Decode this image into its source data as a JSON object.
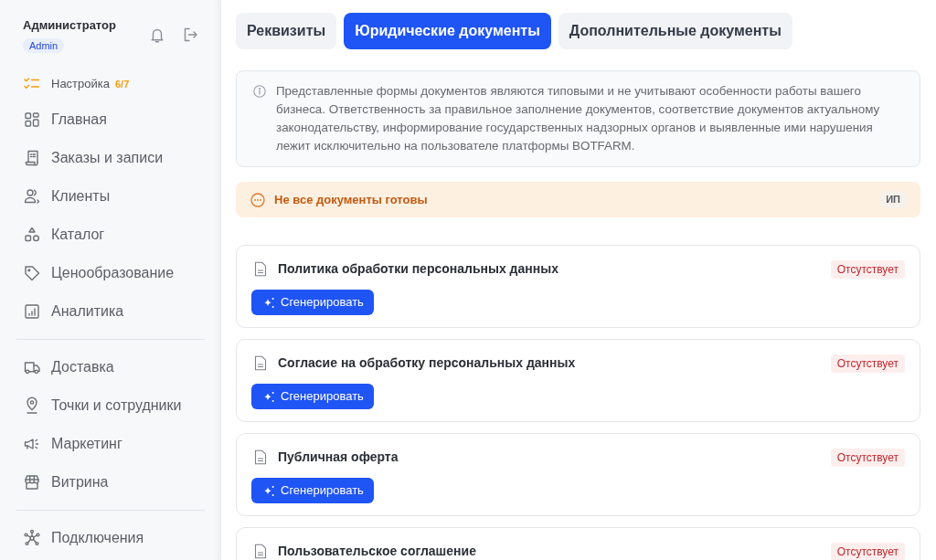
{
  "sidebar": {
    "user": {
      "name": "Администратор",
      "role": "Admin"
    },
    "setup": {
      "label": "Настройка",
      "progress": "6/7"
    },
    "sections": [
      {
        "items": [
          {
            "label": "Главная",
            "selected": false
          },
          {
            "label": "Заказы и записи",
            "selected": false
          },
          {
            "label": "Клиенты",
            "selected": false
          },
          {
            "label": "Каталог",
            "selected": false
          },
          {
            "label": "Ценообразование",
            "selected": false
          },
          {
            "label": "Аналитика",
            "selected": false
          }
        ]
      },
      {
        "items": [
          {
            "label": "Доставка",
            "selected": false
          },
          {
            "label": "Точки и сотрудники",
            "selected": false
          },
          {
            "label": "Маркетинг",
            "selected": false
          },
          {
            "label": "Витрина",
            "selected": false
          }
        ]
      },
      {
        "items": [
          {
            "label": "Подключения",
            "selected": false
          }
        ]
      }
    ]
  },
  "tabs": [
    {
      "label": "Реквизиты",
      "selected": false
    },
    {
      "label": "Юридические документы",
      "selected": true
    },
    {
      "label": "Дополнительные документы",
      "selected": false
    }
  ],
  "notice": {
    "text": "Представленные формы документов являются типовыми и не учитывают особенности работы вашего бизнеса. Ответственность за правильное заполнение документов, соответствие документов актуальному законодательству, информирование государственных надзорных органов и выявленные ими нарушения лежит исключительно на пользователе платформы BOTFARM."
  },
  "warning": {
    "text": "Не все документы готовы",
    "badge": "ИП"
  },
  "documents": [
    {
      "title": "Политика обработки персональных данных",
      "status": "Отсутствует",
      "action": "Сгенерировать"
    },
    {
      "title": "Согласие на обработку персональных данных",
      "status": "Отсутствует",
      "action": "Сгенерировать"
    },
    {
      "title": "Публичная оферта",
      "status": "Отсутствует",
      "action": "Сгенерировать"
    },
    {
      "title": "Пользовательское соглашение",
      "status": "Отсутствует"
    }
  ]
}
